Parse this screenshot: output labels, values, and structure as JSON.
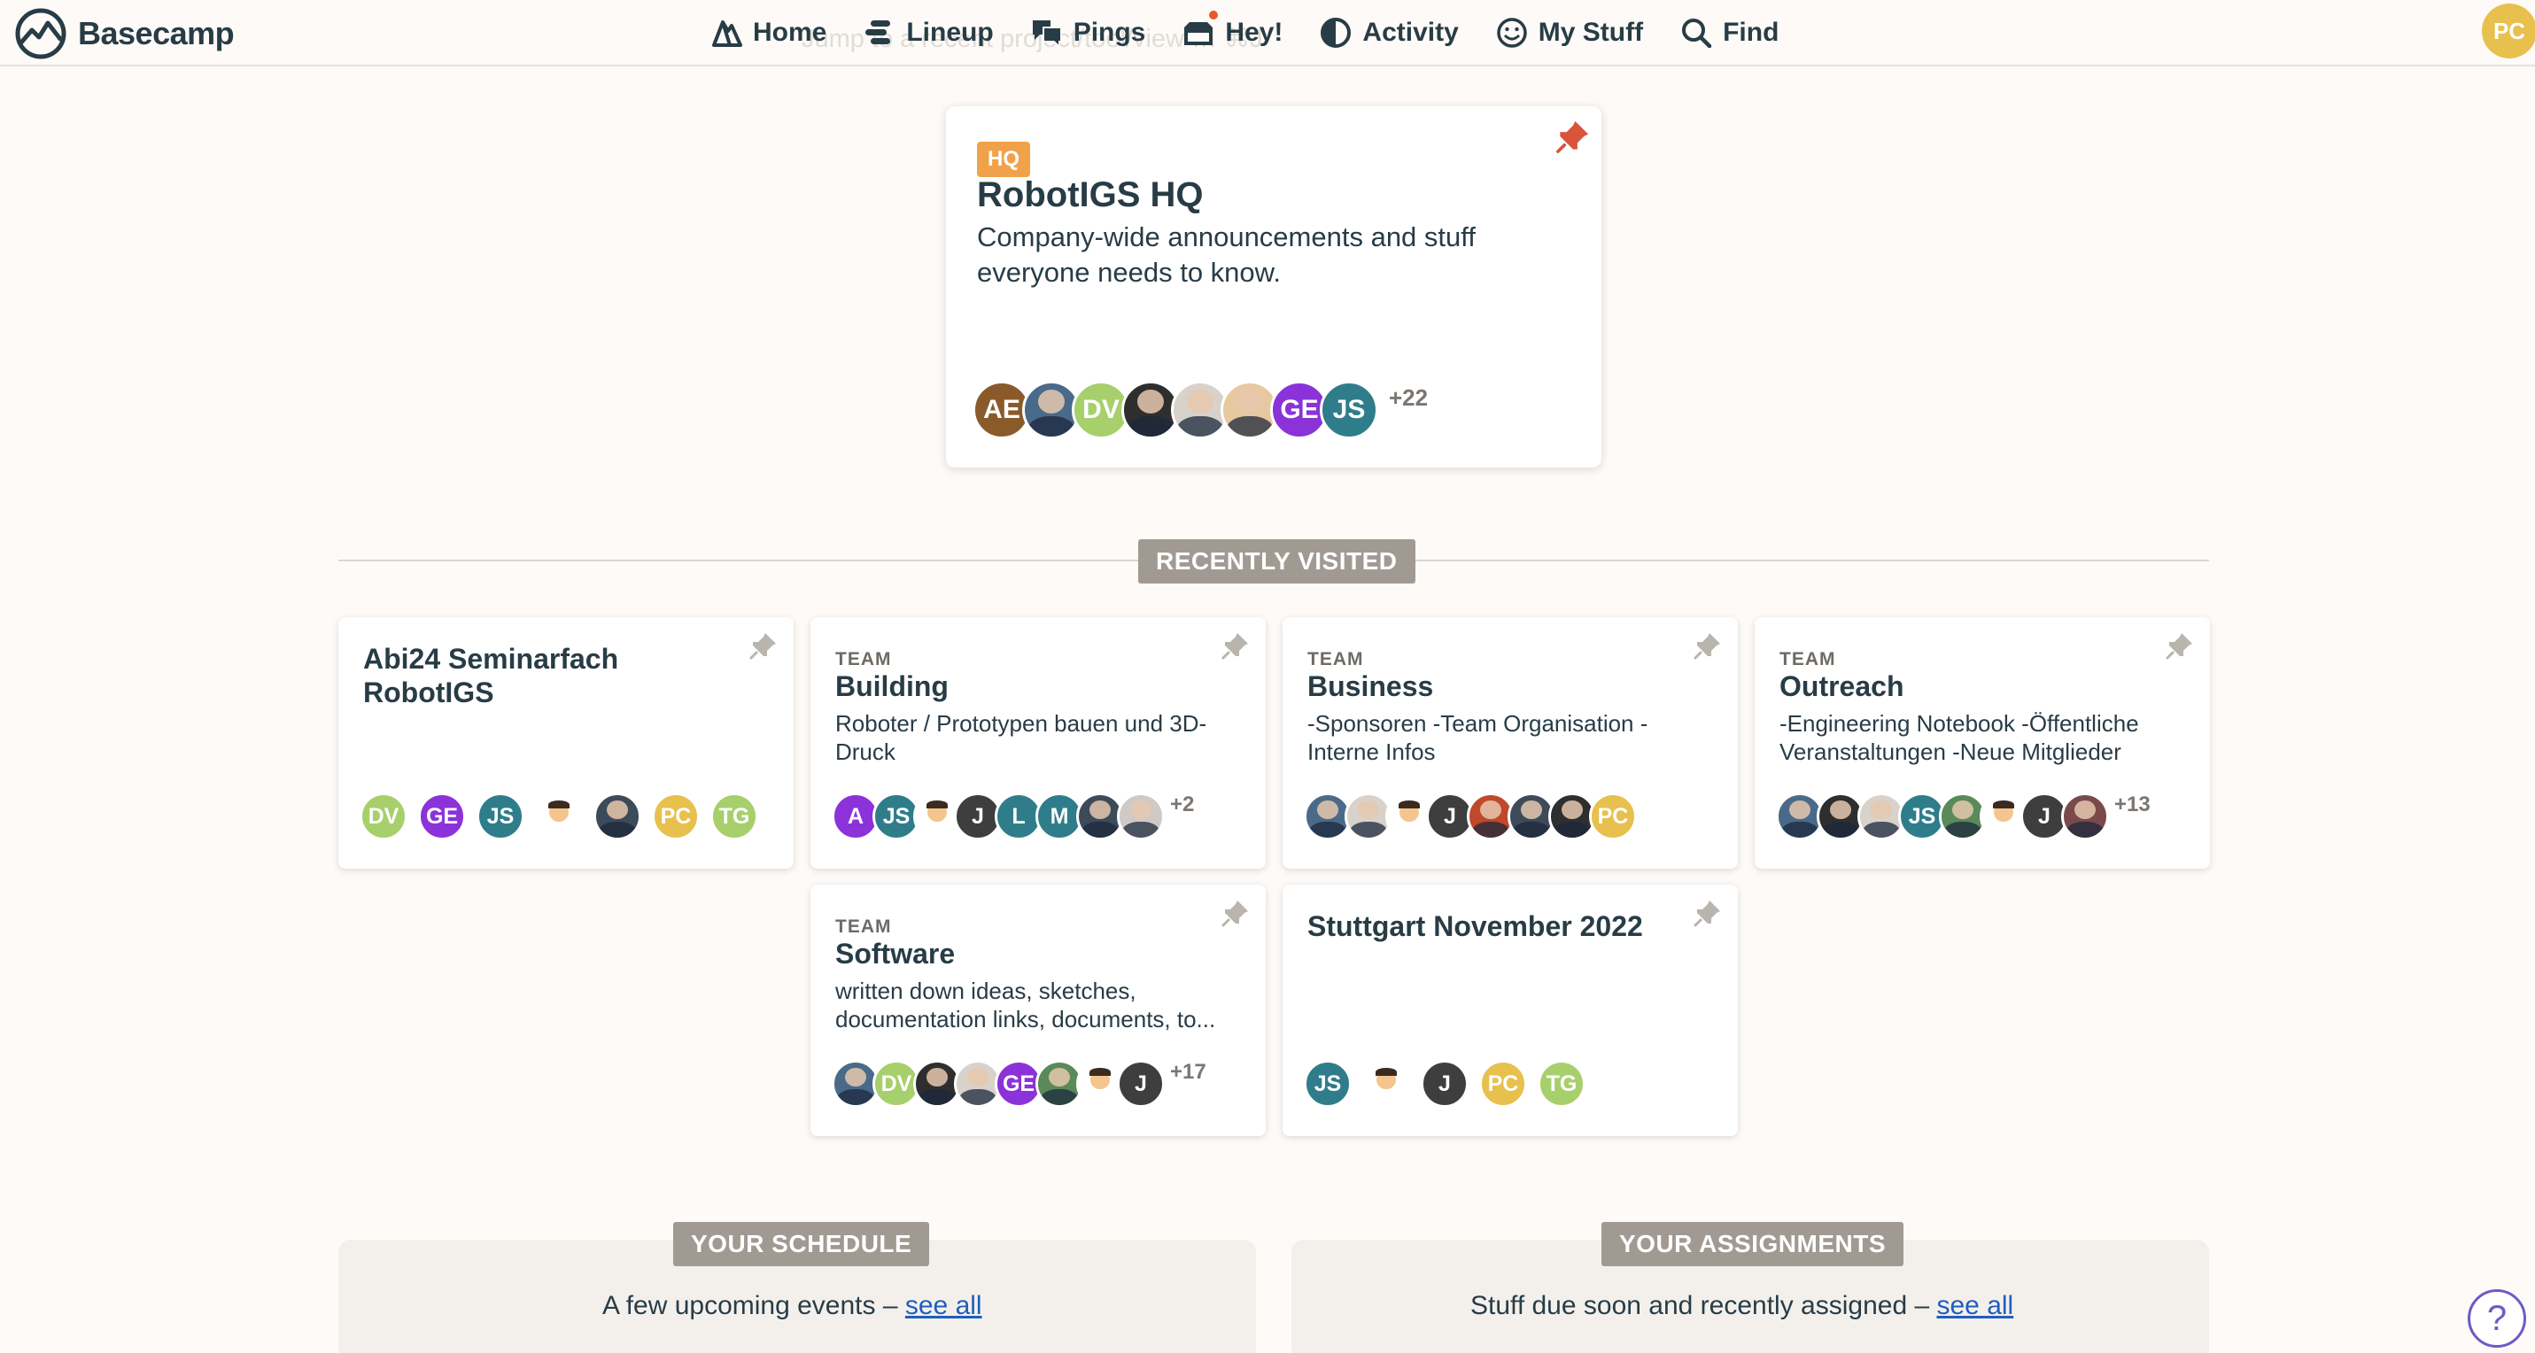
{
  "app": {
    "name": "Basecamp"
  },
  "nav": {
    "items": [
      {
        "label": "Home",
        "icon": "home-icon"
      },
      {
        "label": "Lineup",
        "icon": "lineup-icon"
      },
      {
        "label": "Pings",
        "icon": "pings-icon"
      },
      {
        "label": "Hey!",
        "icon": "hey-icon"
      },
      {
        "label": "Activity",
        "icon": "activity-icon"
      },
      {
        "label": "My Stuff",
        "icon": "smiley-icon"
      },
      {
        "label": "Find",
        "icon": "search-icon"
      }
    ],
    "ghost_hint": "Jump to a recent project/tool/view … ⌘J",
    "current_user_initials": "PC"
  },
  "hq": {
    "badge": "HQ",
    "title": "RobotIGS HQ",
    "description": "Company-wide announcements and stuff everyone needs to know.",
    "more": "+22"
  },
  "recently_visited": {
    "label": "RECENTLY VISITED",
    "projects": [
      {
        "kind": "",
        "title": "Abi24 Seminarfach RobotIGS",
        "description": "",
        "more": ""
      },
      {
        "kind": "TEAM",
        "title": "Building",
        "description": "Roboter / Prototypen bauen und 3D-Druck",
        "more": "+2"
      },
      {
        "kind": "TEAM",
        "title": "Business",
        "description": "-Sponsoren -Team Organisation -Interne Infos",
        "more": ""
      },
      {
        "kind": "TEAM",
        "title": "Outreach",
        "description": "-Engineering Notebook -Öffentliche Veranstaltungen -Neue Mitglieder",
        "more": "+13"
      },
      {
        "kind": "TEAM",
        "title": "Software",
        "description": "written down ideas, sketches, documentation links, documents, to...",
        "more": "+17"
      },
      {
        "kind": "",
        "title": "Stuttgart November 2022",
        "description": "",
        "more": ""
      }
    ]
  },
  "schedule": {
    "label": "YOUR SCHEDULE",
    "text": "A few upcoming events – ",
    "link": "see all"
  },
  "assignments": {
    "label": "YOUR ASSIGNMENTS",
    "text": "Stuff due soon and recently assigned – ",
    "link": "see all"
  },
  "help": {
    "glyph": "?"
  },
  "colors": {
    "background": "#fdfaf7",
    "text": "#283c46",
    "hq_badge": "#f0a24a",
    "section_label": "#a19a93",
    "link": "#1f5fbd",
    "pin_active": "#d9543a",
    "pin_muted": "#b9b4ae"
  },
  "avatars": {
    "hq": [
      "AE",
      "",
      "DV",
      "",
      "",
      "",
      "GE",
      "JS"
    ],
    "abi24": [
      "DV",
      "GE",
      "JS",
      "",
      "",
      "PC",
      "TG"
    ],
    "building": [
      "A",
      "JS",
      "",
      "J",
      "L",
      "M",
      "",
      ""
    ],
    "business": [
      "",
      "",
      "",
      "J",
      "",
      "",
      "",
      "PC"
    ],
    "outreach": [
      "",
      "",
      "",
      "JS",
      "",
      "",
      "J",
      ""
    ],
    "software": [
      "",
      "DV",
      "",
      "",
      "GE",
      "",
      "",
      "J"
    ],
    "stuttgart": [
      "JS",
      "",
      "J",
      "PC",
      "TG"
    ]
  }
}
